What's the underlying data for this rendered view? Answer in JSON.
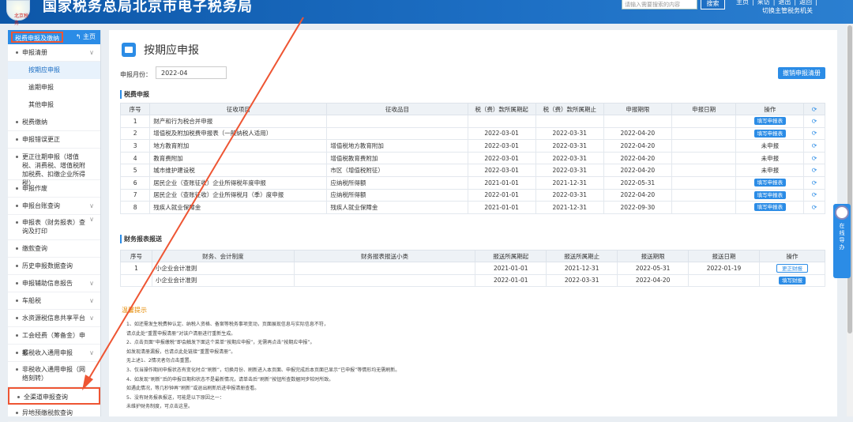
{
  "header": {
    "logo_text": "北京税务",
    "title": "国家税务总局北京市电子税务局",
    "search_placeholder": "请输入需要搜索的内容",
    "search_button": "搜索",
    "links": [
      "主页",
      "|",
      "来访",
      "|",
      "退出",
      "|",
      "返回",
      "|"
    ],
    "switch_org": "切换主管税务机关"
  },
  "sidebar": {
    "title": "税费申报及缴纳",
    "home": "主页",
    "items": [
      {
        "label": "申报清册",
        "type": "item",
        "chev": "∨"
      },
      {
        "label": "按期应申报",
        "type": "sub",
        "active": true
      },
      {
        "label": "逾期申报",
        "type": "sub"
      },
      {
        "label": "其他申报",
        "type": "sub"
      },
      {
        "label": "税费缴纳",
        "type": "item"
      },
      {
        "label": "申报错误更正",
        "type": "item"
      },
      {
        "label": "更正往期申报（增值税、消费税、增值税附加税费、扣缴企业所得税）",
        "type": "tall"
      },
      {
        "label": "申报作废",
        "type": "item"
      },
      {
        "label": "申报台账查询",
        "type": "item",
        "chev": "∨"
      },
      {
        "label": "申报表（财务报表）查询及打印",
        "type": "tall2",
        "chev": "∨"
      },
      {
        "label": "缴款查询",
        "type": "item"
      },
      {
        "label": "历史申报数据查询",
        "type": "item"
      },
      {
        "label": "申报辅助信息报告",
        "type": "item",
        "chev": "∨"
      },
      {
        "label": "车船税",
        "type": "item",
        "chev": "∨"
      },
      {
        "label": "水资源税信息共享平台",
        "type": "item",
        "chev": "∨"
      },
      {
        "label": "工会经费（筹备金）申报",
        "type": "item"
      },
      {
        "label": "非税收入通用申报",
        "type": "item",
        "chev": "∨"
      },
      {
        "label": "非税收入通用申报（网络刻转）",
        "type": "tall2"
      },
      {
        "label": "全渠道申报查询",
        "type": "item",
        "highlight": true
      },
      {
        "label": "异地预缴税款查询",
        "type": "item"
      }
    ]
  },
  "main": {
    "title": "按期应申报",
    "period_label": "申报月份：",
    "period_value": "2022-04",
    "clear_button": "撤销申报清册",
    "tax_section": "税费申报",
    "tax_headers": [
      "序号",
      "征收项目",
      "征收品目",
      "税（费）款所属期起",
      "税（费）款所属期止",
      "申报期限",
      "申报日期",
      "操作",
      ""
    ],
    "tax_rows": [
      {
        "no": "1",
        "item": "财产和行为税合并申报",
        "sub": "",
        "from": "",
        "to": "",
        "deadline": "",
        "date": "",
        "op": "填写申报表",
        "op_type": "btn"
      },
      {
        "no": "2",
        "item": "增值税及附加税费申报表（一般纳税人适用）",
        "sub": "",
        "from": "2022-03-01",
        "to": "2022-03-31",
        "deadline": "2022-04-20",
        "date": "",
        "op": "填写申报表",
        "op_type": "btn"
      },
      {
        "no": "3",
        "item": "地方教育附加",
        "sub": "增值税地方教育附加",
        "from": "2022-03-01",
        "to": "2022-03-31",
        "deadline": "2022-04-20",
        "date": "",
        "op": "未申报",
        "op_type": "text"
      },
      {
        "no": "4",
        "item": "教育费附加",
        "sub": "增值税教育费附加",
        "from": "2022-03-01",
        "to": "2022-03-31",
        "deadline": "2022-04-20",
        "date": "",
        "op": "未申报",
        "op_type": "text"
      },
      {
        "no": "5",
        "item": "城市维护建设税",
        "sub": "市区（增值税附征）",
        "from": "2022-03-01",
        "to": "2022-03-31",
        "deadline": "2022-04-20",
        "date": "",
        "op": "未申报",
        "op_type": "text"
      },
      {
        "no": "6",
        "item": "居民企业（查账征收）企业所得税年度申报",
        "sub": "应纳税所得额",
        "from": "2021-01-01",
        "to": "2021-12-31",
        "deadline": "2022-05-31",
        "date": "",
        "op": "填写申报表",
        "op_type": "btn"
      },
      {
        "no": "7",
        "item": "居民企业（查账征收）企业所得税月（季）度申报",
        "sub": "应纳税所得额",
        "from": "2022-01-01",
        "to": "2022-03-31",
        "deadline": "2022-04-20",
        "date": "",
        "op": "填写申报表",
        "op_type": "btn"
      },
      {
        "no": "8",
        "item": "残疾人就业保障金",
        "sub": "残疾人就业保障金",
        "from": "2021-01-01",
        "to": "2021-12-31",
        "deadline": "2022-09-30",
        "date": "",
        "op": "填写申报表",
        "op_type": "btn"
      }
    ],
    "fin_section": "财务报表报送",
    "fin_headers": [
      "序号",
      "财务、会计制度",
      "财务报表报送小类",
      "报送所属期起",
      "报送所属期止",
      "报送期限",
      "报送日期",
      "操作"
    ],
    "fin_rows": [
      {
        "no": "1",
        "system": "小企业会计准则",
        "sub": "",
        "from": "2021-01-01",
        "to": "2021-12-31",
        "deadline": "2022-05-31",
        "date": "2022-01-19",
        "op": "更正财报",
        "op_type": "line"
      },
      {
        "no": "",
        "system": "小企业会计准则",
        "sub": "",
        "from": "2022-01-01",
        "to": "2022-03-31",
        "deadline": "2022-04-20",
        "date": "",
        "op": "填写财报",
        "op_type": "btn"
      }
    ],
    "tips_title": "温馨提示",
    "tips": [
      "1、如还需发生税费种认定、纳税人资格、备案等税务事项变动，页面展现信息与实际信息不符，",
      "请点此处“重置申报清册”对该户清册进行重新生成。",
      "2、点击页面“申报缴税”即会触发下面这个菜单“按期应申报”，无需再点击“按期应申报”。",
      "如发现清册漏报，也请点此处链接“重置申报清册”。",
      "无上述1、2情况者勿点击重置。",
      "3、仅当操作期间申报状态有变化时点“刷新”，切换月份、刷新进入本页面、申报完成后本页面已显示“已申报”等情形均无需刷新。",
      "4、如发现“刷新”后的申报日期和状态不是最新情况，请单击后“刷新”按钮所查数据同步较时所致。",
      "如遇此情况，等几秒钟再“刷新”或退出刷新后进申报清册查看。",
      "5、没有财务报表报送，可能是以下原因之一：",
      "未维护财务制度，可点击这里。"
    ]
  },
  "widget": {
    "text": "在线导办"
  }
}
